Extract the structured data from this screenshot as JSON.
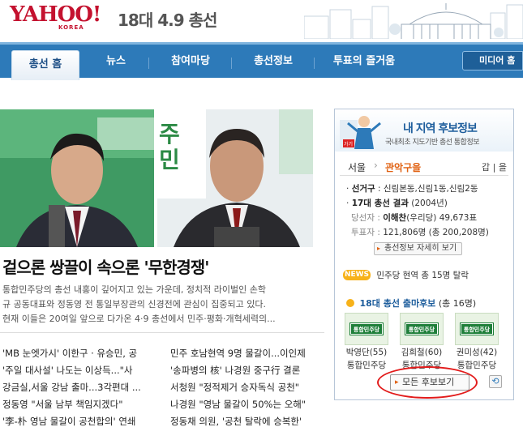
{
  "header": {
    "logo_text": "YAHOO!",
    "logo_sub": "KOREA",
    "title": "18대 4.9 총선"
  },
  "nav": {
    "items": [
      {
        "label": "총선 홈"
      },
      {
        "label": "뉴스"
      },
      {
        "label": "참여마당"
      },
      {
        "label": "총선정보"
      },
      {
        "label": "투표의 즐거움"
      }
    ],
    "media_button": "미디어 홈"
  },
  "main": {
    "headline": "겉으론 쌍끌이 속으론 '무한경쟁'",
    "body_lines": [
      "통합민주당의 총선 내홍이 깊어지고 있는 가운데, 정치적 라이벌인 손학",
      "규 공동대표와 정동영 전 통일부장관의 신경전에 관심이 집중되고 있다.",
      "현재 이들은 20여일 앞으로 다가온 4·9 총선에서 민주·평화·개혁세력의..."
    ],
    "left_list": [
      "'MB 눈엣가시' 이한구 · 유승민, 공",
      "'주일 대사설' 나도는 이상득...\"사",
      "강금실,서울 강남 출마...3각편대 ...",
      "정동영 \"서울 남부 책임지겠다\"",
      "'李-朴 영남 물갈이 공천합의' 연쇄"
    ],
    "right_list": [
      "민주 호남현역 9명 물갈이...이인제",
      "'송파병의 核' 나경원 중구行 결론",
      "서청원 \"정적제거 승자독식 공천\"",
      "나경원 \"영남 물갈이 50%는 오해\"",
      "정동채 의원, '공천 탈락에 승복한'"
    ]
  },
  "candidate_box": {
    "title": "내 지역 후보정보",
    "subtitle": "국내최초 지도기반 총선 통합정보",
    "city": "서울",
    "district": "관악구을",
    "index_keys": "갑 | 을",
    "constituency_label": "선거구",
    "constituency_value": ": 신림본동,신림1동,신림2동",
    "prev_result_label": "17대 총선 결과",
    "prev_result_year": "(2004년)",
    "winner_label": "당선자 :",
    "winner_name": "이해찬",
    "winner_party": "(우리당)",
    "winner_votes": "49,673표",
    "turnout_label": "투표자 :",
    "turnout_value": "121,806명 (총 200,208명)",
    "detail_button": "총선정보 자세히 보기",
    "news_badge": "NEWS",
    "news_text": "민주당 현역 총 15명 탈락",
    "section_title": "18대 총선 출마후보",
    "section_count": "(총 16명)",
    "party_logo": "통합민주당",
    "candidates": [
      {
        "name": "박영단(55)",
        "party": "통합민주당"
      },
      {
        "name": "김희철(60)",
        "party": "통합민주당"
      },
      {
        "name": "권미성(42)",
        "party": "통합민주당"
      }
    ],
    "more_button": "모든 후보보기",
    "refresh_icon": "⟲"
  }
}
